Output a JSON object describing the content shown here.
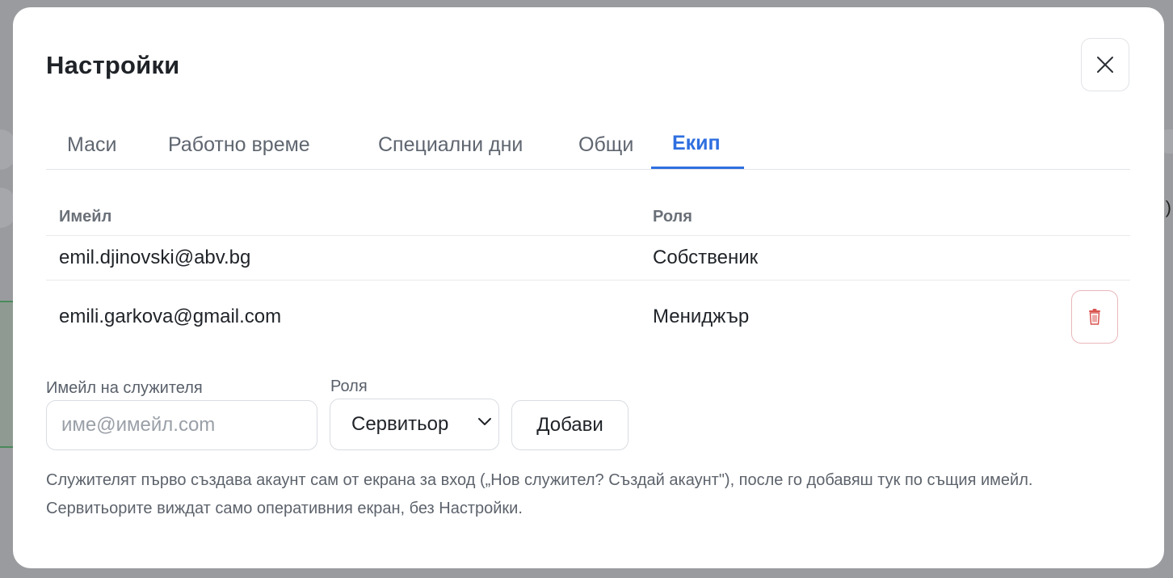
{
  "modal": {
    "title": "Настройки"
  },
  "tabs": [
    {
      "label": "Маси",
      "active": false
    },
    {
      "label": "Работно време",
      "active": false
    },
    {
      "label": "Специални дни",
      "active": false
    },
    {
      "label": "Общи",
      "active": false
    },
    {
      "label": "Екип",
      "active": true
    }
  ],
  "team_table": {
    "headers": {
      "email": "Имейл",
      "role": "Роля"
    },
    "rows": [
      {
        "email": "emil.djinovski@abv.bg",
        "role": "Собственик",
        "deletable": false
      },
      {
        "email": "emili.garkova@gmail.com",
        "role": "Мениджър",
        "deletable": true
      }
    ]
  },
  "add_form": {
    "email_label": "Имейл на служителя",
    "email_placeholder": "име@имейл.com",
    "email_value": "",
    "role_label": "Роля",
    "role_selected": "Сервитьор",
    "add_button": "Добави"
  },
  "help_text": "Служителят първо създава акаунт сам от екрана за вход („Нов служител? Създай акаунт\"), после го добавяш тук по същия имейл. Сервитьорите виждат само оперативния екран, без Настройки.",
  "background": {
    "right_edge_glyph": ")"
  },
  "colors": {
    "accent": "#2f6fe0",
    "danger": "#d9534f",
    "overlay": "#9a9b9e"
  },
  "icons": {
    "close": "close-icon",
    "delete": "trash-icon",
    "dropdown": "chevron-down-icon"
  }
}
